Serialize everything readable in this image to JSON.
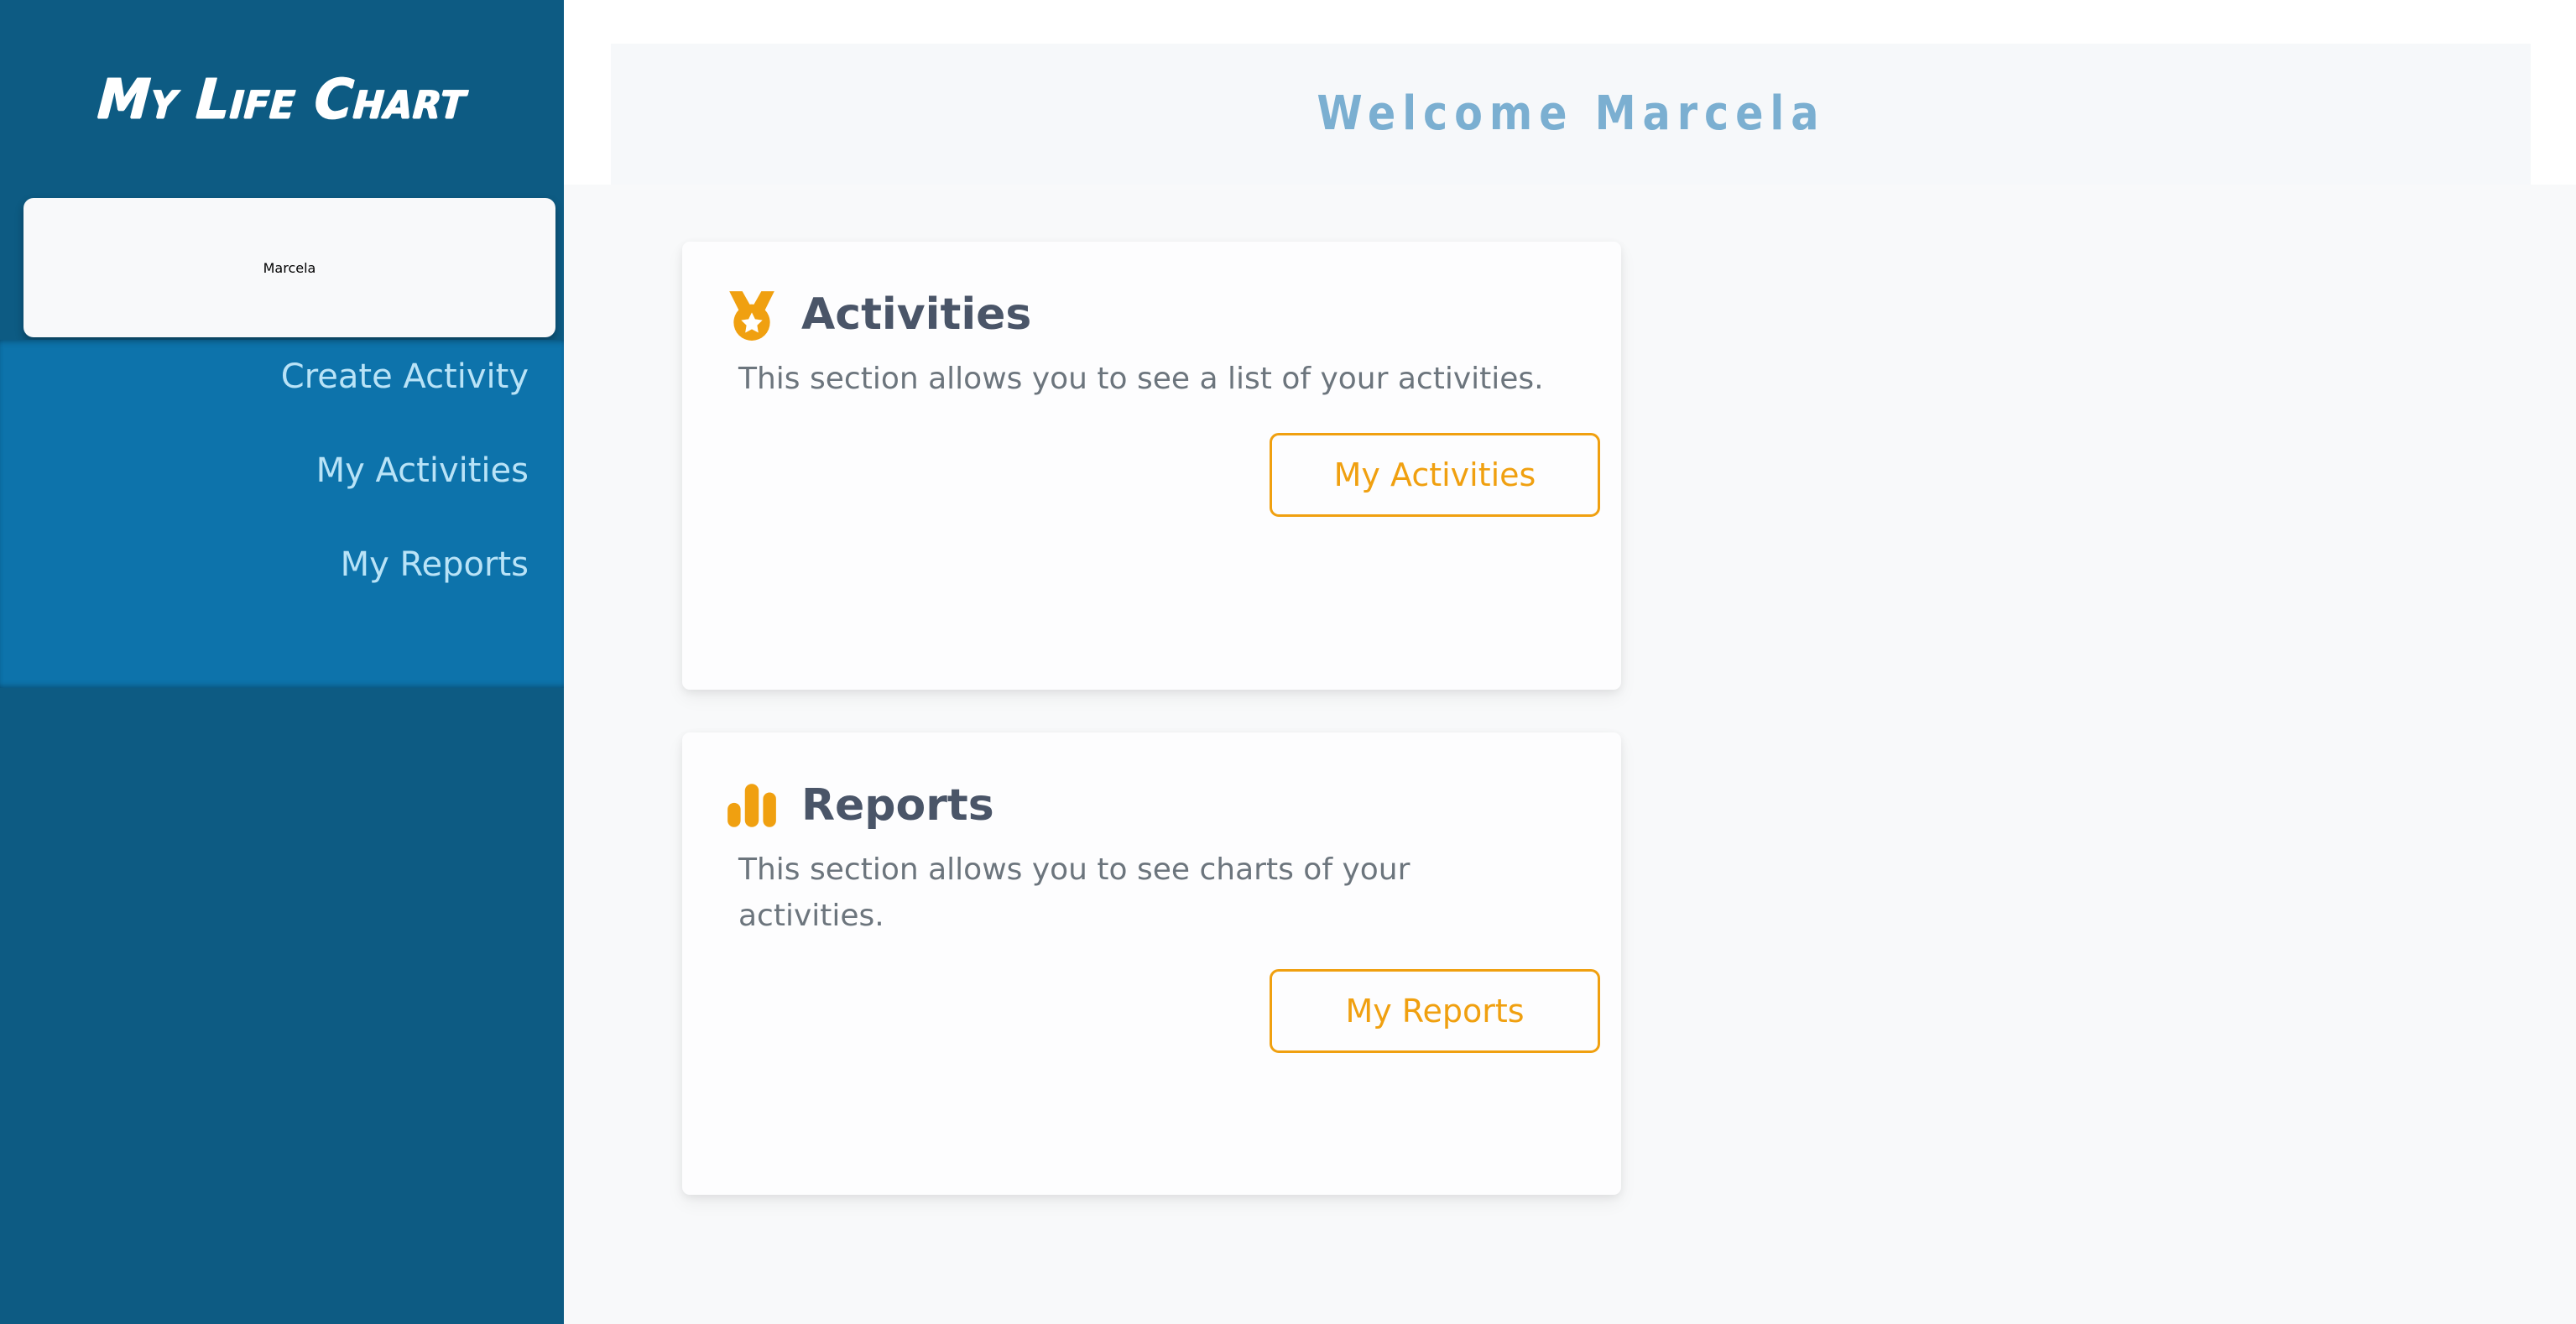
{
  "sidebar": {
    "brand": "My Life Chart",
    "user_chip": {
      "label": "Marcela",
      "icon": "user-chip"
    },
    "nav_items": [
      {
        "label": "Create Activity",
        "name": "create-activity"
      },
      {
        "label": "My Activities",
        "name": "my-activities"
      },
      {
        "label": "My Reports",
        "name": "my-reports"
      }
    ],
    "colors": {
      "background": "#0d5b83",
      "nav_background": "#0d73ab",
      "nav_text": "#b9e3f7",
      "chip_background": "#f8f9fa",
      "chip_text": "#6c757d"
    }
  },
  "header": {
    "title": "Welcome Marcela",
    "band_background": "#f6f8fa",
    "title_color": "#7bafd1"
  },
  "main": {
    "background": "#f8f9fa",
    "cards": [
      {
        "name": "activities",
        "icon": "medal-icon",
        "title": "Activities",
        "description": "This section allows you to see a list of your activities.",
        "button_label": "My Activities"
      },
      {
        "name": "reports",
        "icon": "bar-chart-icon",
        "title": "Reports",
        "description": "This section allows you to see charts of your activities.",
        "button_label": "My Reports"
      }
    ],
    "accent_color": "#f0a010",
    "card_title_color": "#4a5568",
    "card_text_color": "#6c757d",
    "card_background": "#fdfdfe"
  }
}
